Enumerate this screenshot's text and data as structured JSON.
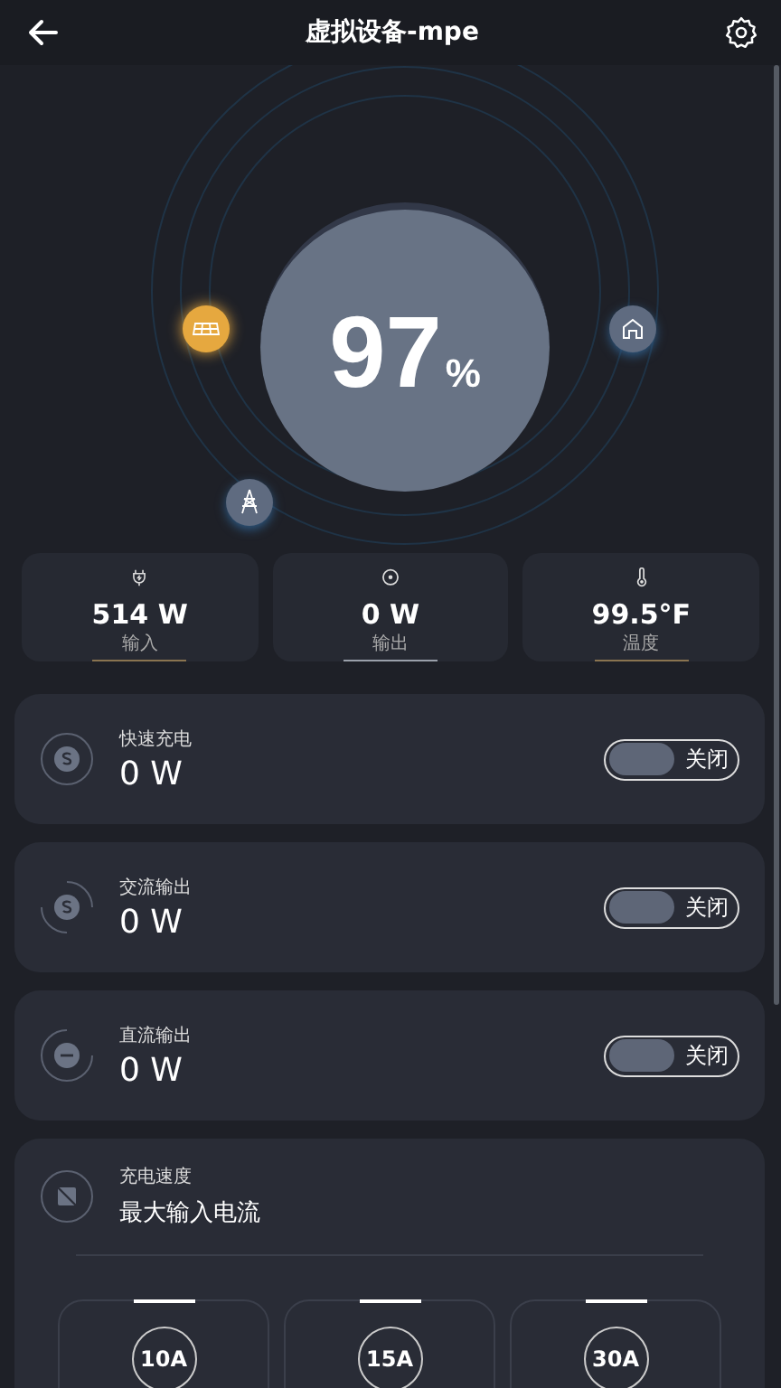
{
  "header": {
    "title": "虚拟设备-mpe"
  },
  "battery": {
    "value": "97",
    "unit": "%"
  },
  "stats": [
    {
      "kind": "plug",
      "value": "514 W",
      "label": "输入",
      "color": "#8a7450"
    },
    {
      "kind": "target",
      "value": "0 W",
      "label": "输出",
      "color": "#9aa0aa"
    },
    {
      "kind": "thermo",
      "value": "99.5°F",
      "label": "温度",
      "color": "#8a7450"
    }
  ],
  "switches": [
    {
      "kind": "fast",
      "label": "快速充电",
      "value": "0 W",
      "on": false,
      "state": "关闭"
    },
    {
      "kind": "ac",
      "label": "交流输出",
      "value": "0 W",
      "on": false,
      "state": "关闭"
    },
    {
      "kind": "dc",
      "label": "直流输出",
      "value": "0 W",
      "on": false,
      "state": "关闭"
    }
  ],
  "charge_speed": {
    "label": "充电速度",
    "value": "最大输入电流",
    "options": [
      {
        "label": "10A"
      },
      {
        "label": "15A"
      },
      {
        "label": "30A"
      }
    ]
  }
}
